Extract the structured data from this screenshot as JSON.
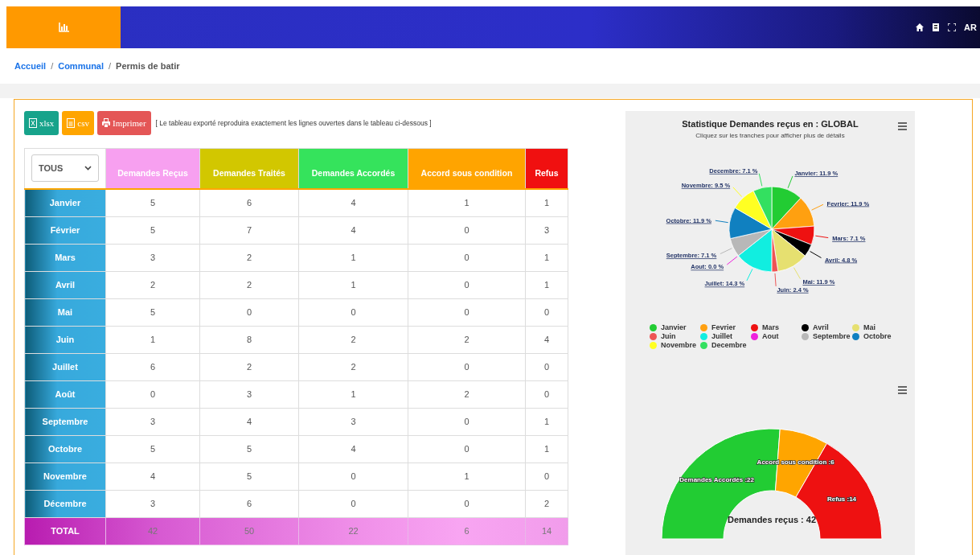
{
  "header": {
    "language": "AR"
  },
  "breadcrumb": {
    "separator": "/",
    "items": [
      {
        "label": "Accueil",
        "link": true
      },
      {
        "label": "Communal",
        "link": true
      },
      {
        "label": "Permis de batir",
        "link": false
      }
    ]
  },
  "toolbar": {
    "buttons": [
      {
        "kind": "xlsx",
        "label": "xlsx"
      },
      {
        "kind": "csv",
        "label": "csv"
      },
      {
        "kind": "print",
        "label": "Imprimer"
      }
    ],
    "note": "[ Le tableau exporté reproduira exactement les lignes ouvertes dans le tableau ci-dessous ]"
  },
  "table": {
    "filter": {
      "value": "TOUS"
    },
    "columns": [
      {
        "label": "Demandes Reçus",
        "color": "#f7a0f0"
      },
      {
        "label": "Demandes Traités",
        "color": "#d2c700"
      },
      {
        "label": "Demandes Accordés",
        "color": "#35e35c"
      },
      {
        "label": "Accord sous condition",
        "color": "#ffa400"
      },
      {
        "label": "Refus",
        "color": "#f01010"
      }
    ],
    "rows": [
      {
        "month": "Janvier",
        "values": [
          "5",
          "6",
          "4",
          "1",
          "1"
        ]
      },
      {
        "month": "Février",
        "values": [
          "5",
          "7",
          "4",
          "0",
          "3"
        ]
      },
      {
        "month": "Mars",
        "values": [
          "3",
          "2",
          "1",
          "0",
          "1"
        ]
      },
      {
        "month": "Avril",
        "values": [
          "2",
          "2",
          "1",
          "0",
          "1"
        ]
      },
      {
        "month": "Mai",
        "values": [
          "5",
          "0",
          "0",
          "0",
          "0"
        ]
      },
      {
        "month": "Juin",
        "values": [
          "1",
          "8",
          "2",
          "2",
          "4"
        ]
      },
      {
        "month": "Juillet",
        "values": [
          "6",
          "2",
          "2",
          "0",
          "0"
        ]
      },
      {
        "month": "Août",
        "values": [
          "0",
          "3",
          "1",
          "2",
          "0"
        ]
      },
      {
        "month": "Septembre",
        "values": [
          "3",
          "4",
          "3",
          "0",
          "1"
        ]
      },
      {
        "month": "Octobre",
        "values": [
          "5",
          "5",
          "4",
          "0",
          "1"
        ]
      },
      {
        "month": "Novembre",
        "values": [
          "4",
          "5",
          "0",
          "1",
          "0"
        ]
      },
      {
        "month": "Décembre",
        "values": [
          "3",
          "6",
          "0",
          "0",
          "2"
        ]
      }
    ],
    "total": {
      "label": "TOTAL",
      "values": [
        "42",
        "50",
        "22",
        "6",
        "14"
      ]
    }
  },
  "pie": {
    "title": "Statistique Demandes reçus en : GLOBAL",
    "subtitle": "Cliquez sur les tranches pour afficher plus de détails",
    "chart_data": {
      "type": "pie",
      "categories": [
        "Janvier",
        "Fevrier",
        "Mars",
        "Avril",
        "Mai",
        "Juin",
        "Juillet",
        "Aout",
        "Septembre",
        "Octobre",
        "Novembre",
        "Decembre"
      ],
      "values": [
        11.9,
        11.9,
        7.1,
        4.8,
        11.9,
        2.4,
        14.3,
        0.0,
        7.1,
        11.9,
        9.5,
        7.1
      ],
      "colors": [
        "#22cc33",
        "#ffa010",
        "#ee1111",
        "#000000",
        "#e6e070",
        "#ee5555",
        "#11eee0",
        "#ee22dd",
        "#b8b8b8",
        "#1080c0",
        "#ffff22",
        "#33e060"
      ],
      "value_labels": [
        "Janvier: 11.9 %",
        "Fevrier: 11.9 %",
        "Mars: 7.1 %",
        "Avril: 4.8 %",
        "Mai: 11.9 %",
        "Juin: 2.4 %",
        "Juillet: 14.3 %",
        "Aout: 0.0 %",
        "Septembre: 7.1 %",
        "Octobre: 11.9 %",
        "Novembre: 9.5 %",
        "Decembre: 7.1 %"
      ]
    }
  },
  "gauge": {
    "center_label": "Demandes reçus : 42",
    "chart_data": {
      "type": "donut",
      "values": [
        22,
        6,
        14
      ],
      "colors": [
        "#22cc33",
        "#ffa500",
        "#ee1111"
      ],
      "value_labels": [
        "Demandes Accordés :22",
        "Accord sous condition :6",
        "Refus :14"
      ]
    }
  }
}
